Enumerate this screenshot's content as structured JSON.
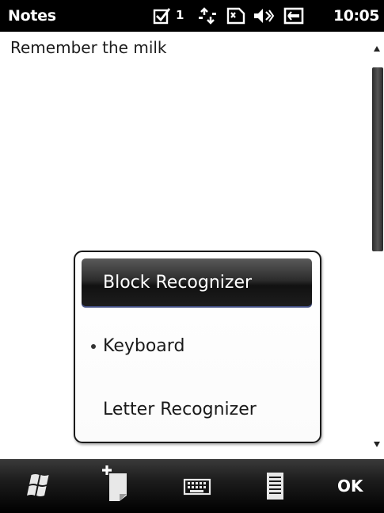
{
  "status_bar": {
    "app_title": "Notes",
    "notification_count": "1",
    "time": "10:05",
    "icons": [
      "tasks-checkbox-icon",
      "connectivity-arrows-icon",
      "sim-card-icon",
      "speaker-muted-icon",
      "battery-icon"
    ]
  },
  "note": {
    "text": "Remember the milk"
  },
  "input_menu": {
    "items": [
      {
        "label": "Block Recognizer",
        "selected": true,
        "current": false
      },
      {
        "label": "Keyboard",
        "selected": false,
        "current": true
      },
      {
        "label": "Letter Recognizer",
        "selected": false,
        "current": false
      }
    ]
  },
  "softkeys": {
    "start_icon": "windows-flag-icon",
    "new_note_icon": "new-note-icon",
    "input_panel_icon": "keyboard-icon",
    "menu_icon": "menu-list-icon",
    "ok_label": "OK"
  },
  "colors": {
    "status_bar_bg": "#000000",
    "softkey_bar_bg": "#1c1c1c",
    "selection_bg": "#2b2b2b"
  }
}
